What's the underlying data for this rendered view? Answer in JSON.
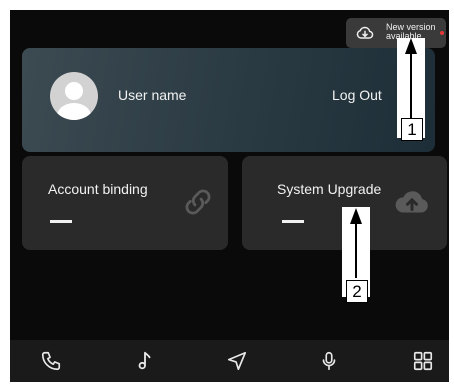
{
  "notification": {
    "text_line1": "New version",
    "text_line2": "available",
    "icon": "cloud-download-icon"
  },
  "user": {
    "name": "User name",
    "logout_label": "Log Out",
    "avatar_icon": "user-avatar-icon"
  },
  "cards": [
    {
      "label": "Account binding",
      "value": "—",
      "icon": "link-icon"
    },
    {
      "label": "System Upgrade",
      "value": "—",
      "icon": "cloud-upload-icon"
    }
  ],
  "bottom_nav": [
    {
      "icon": "phone-icon"
    },
    {
      "icon": "music-icon"
    },
    {
      "icon": "navigation-icon"
    },
    {
      "icon": "microphone-icon"
    },
    {
      "icon": "apps-grid-icon"
    }
  ],
  "callouts": [
    {
      "label": "1"
    },
    {
      "label": "2"
    }
  ],
  "colors": {
    "screen_bg": "#0a0a0a",
    "card_bg": "#2a2a2a",
    "text": "#f2f2f2",
    "icon_muted": "#5a5a5a",
    "badge_dot": "#e53935"
  }
}
